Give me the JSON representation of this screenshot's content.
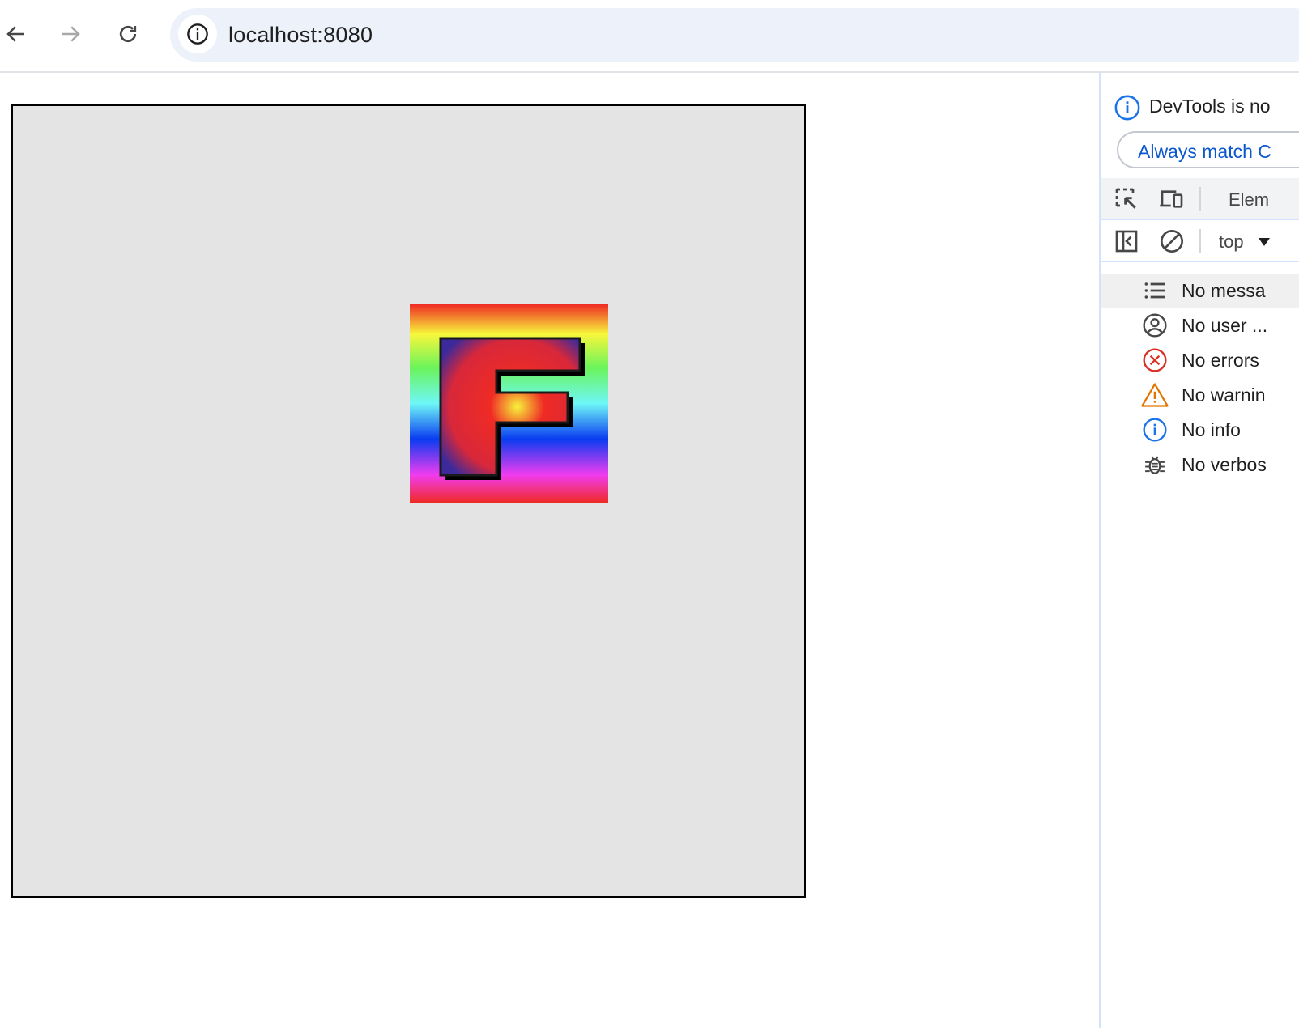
{
  "browser": {
    "url": "localhost:8080",
    "icons": [
      "back-arrow-icon",
      "forward-arrow-icon",
      "reload-icon",
      "site-info-icon"
    ]
  },
  "page": {
    "logo_letter": "F",
    "colors": {
      "stage_background": "#e4e4e4",
      "stage_border": "#000000",
      "rainbow": [
        "#ef2b24",
        "#f7f73b",
        "#6bf45b",
        "#6ef7f7",
        "#0a3cf0",
        "#f03cf0",
        "#ef2b24"
      ]
    }
  },
  "devtools": {
    "banner_text": "DevTools is no",
    "match_button_label": "Always match C",
    "tab_label": "Elem",
    "context_label": "top",
    "sidebar": [
      {
        "label": "No messa",
        "icon": "list-icon"
      },
      {
        "label": "No user ...",
        "icon": "user-circle-icon"
      },
      {
        "label": "No errors",
        "icon": "error-circle-icon"
      },
      {
        "label": "No warnin",
        "icon": "warning-triangle-icon"
      },
      {
        "label": "No info",
        "icon": "info-circle-icon"
      },
      {
        "label": "No verbos",
        "icon": "bug-icon"
      }
    ],
    "colors": {
      "info_blue": "#1a73e8",
      "link_blue": "#0b57d0",
      "error_red": "#d93025",
      "warning_orange": "#e37400"
    }
  }
}
